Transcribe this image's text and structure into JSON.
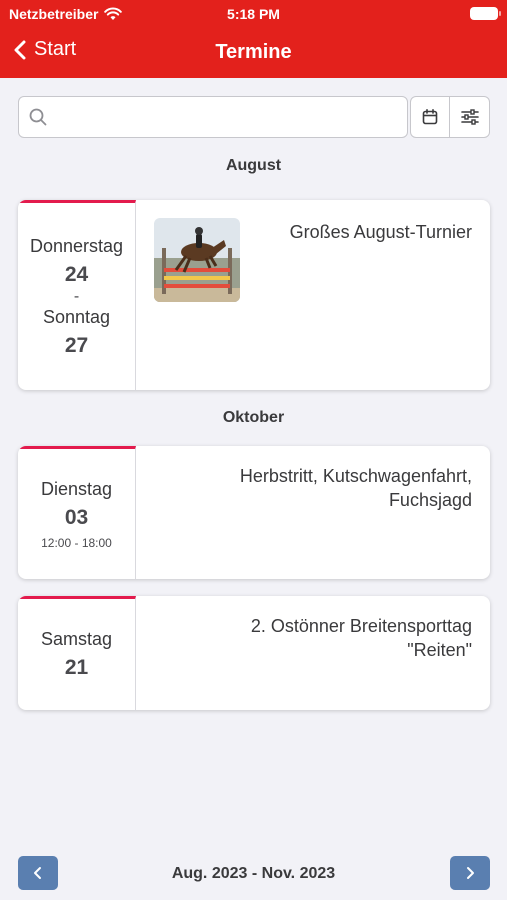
{
  "status_bar": {
    "carrier": "Netzbetreiber",
    "time": "5:18 PM"
  },
  "nav": {
    "back_label": "Start",
    "title": "Termine"
  },
  "search": {
    "placeholder": "",
    "value": ""
  },
  "groups": [
    {
      "month": "August"
    },
    {
      "month": "Oktober"
    }
  ],
  "events": [
    {
      "weekday_start": "Donnerstag",
      "day_start": "24",
      "separator": "-",
      "weekday_end": "Sonntag",
      "day_end": "27",
      "title": "Großes August-Turnier"
    },
    {
      "weekday": "Dienstag",
      "day": "03",
      "time": "12:00 - 18:00",
      "title_line1": "Herbstritt, Kutschwagenfahrt,",
      "title_line2": "Fuchsjagd"
    },
    {
      "weekday": "Samstag",
      "day": "21",
      "title_line1": "2. Ostönner Breitensporttag",
      "title_line2": "\"Reiten\""
    }
  ],
  "pager": {
    "range": "Aug. 2023 - Nov. 2023"
  },
  "icons": {
    "back": "chevron-left-icon",
    "search": "search-icon",
    "calendar": "calendar-icon",
    "filter": "sliders-icon",
    "prev": "chevron-left-icon",
    "next": "chevron-right-icon"
  },
  "colors": {
    "header": "#e3211c",
    "accent": "#e31b4d",
    "pager_button": "#5a7fb0",
    "background": "#f2f2f7"
  }
}
